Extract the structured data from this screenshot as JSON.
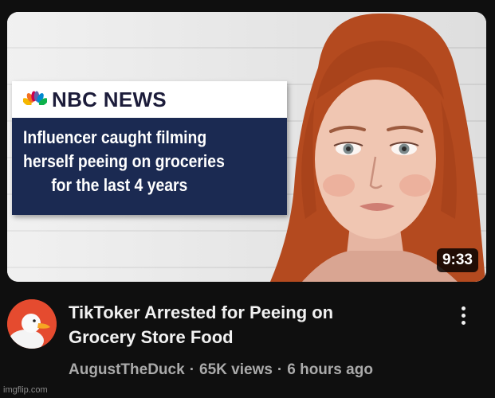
{
  "thumbnail": {
    "news_brand": "NBC NEWS",
    "headline_lines": [
      "Influencer caught filming",
      "herself peeing on groceries",
      "for the last 4 years"
    ],
    "duration": "9:33",
    "brand_colors": {
      "banner_bg": "#1b2a52",
      "header_bg": "#ffffff",
      "brand_text": "#1c1c3a"
    }
  },
  "video": {
    "title_lines": [
      "TikToker Arrested for Peeing on",
      "Grocery Store Food"
    ],
    "channel": "AugustTheDuck",
    "views": "65K views",
    "age": "6 hours ago",
    "separator": "·"
  },
  "avatar": {
    "icon": "duck-avatar-icon",
    "bg_color": "#e54b2f"
  },
  "menu": {
    "icon": "more-vert-icon"
  },
  "watermark": "imgflip.com"
}
